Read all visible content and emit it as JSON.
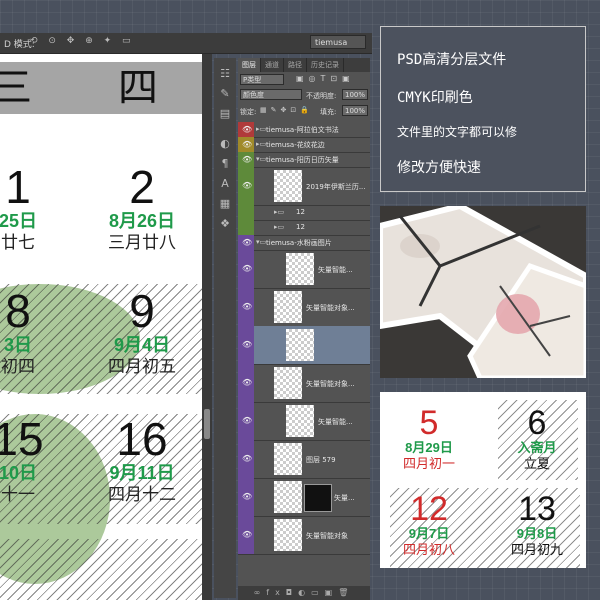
{
  "topbar": {
    "mode": "D 模式:",
    "brand": "tiemusa"
  },
  "calendar": {
    "weekday_left": "三",
    "weekday_right": "四",
    "cells": [
      {
        "num": "1",
        "greg": "25日",
        "lunar": "廿七"
      },
      {
        "num": "2",
        "greg": "8月26日",
        "lunar": "三月廿八"
      },
      {
        "num": "8",
        "greg": "3日",
        "lunar": "初四"
      },
      {
        "num": "9",
        "greg": "9月4日",
        "lunar": "四月初五"
      },
      {
        "num": "15",
        "greg": "10日",
        "lunar": "十一"
      },
      {
        "num": "16",
        "greg": "9月11日",
        "lunar": "四月十二"
      }
    ]
  },
  "layers_panel": {
    "tabs": [
      "图层",
      "通道",
      "路径",
      "历史记录"
    ],
    "kind_label": "P类型",
    "blend_mode": "颜色度",
    "opacity_label": "不透明度:",
    "opacity_value": "100%",
    "lock_label": "锁定:",
    "fill_label": "填充:",
    "fill_value": "100%",
    "layers": [
      {
        "name": "tiemusa-阿拉伯文书法",
        "color": "#b03a3a",
        "type": "group"
      },
      {
        "name": "tiemusa-花纹花边",
        "color": "#a08a2a",
        "type": "group"
      },
      {
        "name": "tiemusa-阳历日历矢量",
        "color": "#5e8a3a",
        "type": "group"
      },
      {
        "name": "2019年伊斯兰历...",
        "color": "#5e8a3a",
        "type": "layer"
      },
      {
        "name": "12",
        "color": "#5e8a3a",
        "type": "group"
      },
      {
        "name": "12",
        "color": "#5e8a3a",
        "type": "group"
      },
      {
        "name": "tiemusa-水粉画图片",
        "color": "#6a4a9a",
        "type": "group"
      },
      {
        "name": "矢量智能...",
        "color": "#6a4a9a",
        "type": "layer"
      },
      {
        "name": "矢量智能对象...",
        "color": "#6a4a9a",
        "type": "layer"
      },
      {
        "name": "",
        "color": "#6a4a9a",
        "type": "layer"
      },
      {
        "name": "矢量智能对象...",
        "color": "#6a4a9a",
        "type": "layer"
      },
      {
        "name": "矢量智能...",
        "color": "#6a4a9a",
        "type": "layer"
      },
      {
        "name": "图层 579",
        "color": "#6a4a9a",
        "type": "layer"
      },
      {
        "name": "矢量...",
        "color": "#6a4a9a",
        "type": "layer"
      },
      {
        "name": "矢量智能对象",
        "color": "#6a4a9a",
        "type": "layer"
      }
    ]
  },
  "promo": {
    "line1": "PSD高清分层文件",
    "line2": "CMYK印刷色",
    "line3": "文件里的文字都可以修",
    "line4": "修改方便快速"
  },
  "sample": {
    "cells": [
      {
        "num": "5",
        "greg": "8月29日",
        "lunar": "四月初一"
      },
      {
        "num": "6",
        "greg": "入斋月",
        "lunar": "立夏"
      },
      {
        "num": "12",
        "greg": "9月7日",
        "lunar": "四月初八"
      },
      {
        "num": "13",
        "greg": "9月8日",
        "lunar": "四月初九"
      }
    ]
  },
  "colors": {
    "accent_green": "#1f9a4a",
    "accent_red": "#d12b2b",
    "bg": "#4a515e"
  }
}
